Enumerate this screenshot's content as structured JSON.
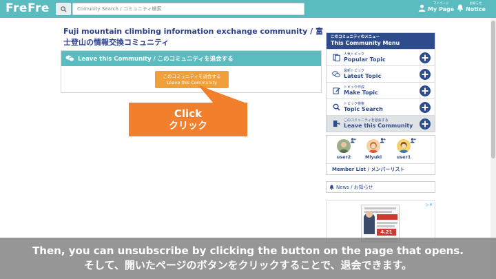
{
  "header": {
    "logo": "FreFre",
    "search_placeholder": "Comunity Search / コミュニティ検索",
    "mypage_small": "マイページ",
    "mypage_label": "My Page",
    "notice_small": "お知らせ",
    "notice_label": "Notice"
  },
  "main": {
    "title": "Fuji mountain climbing information exchange community / 富士登山の情報交換コミュニティ",
    "leave_header": "Leave this Community / このコミュニティを退会する",
    "leave_button_ja": "このコミュニティを退会する",
    "leave_button_en": "Leave this Community"
  },
  "callout": {
    "line1": "Click",
    "line2": "クリック"
  },
  "menu": {
    "head_small": "このコミュニティのメニュー",
    "head_big": "This Community Menu",
    "items": [
      {
        "small": "人気トピック",
        "big": "Popular Topic"
      },
      {
        "small": "最新トピック",
        "big": "Latest Topic"
      },
      {
        "small": "トピック作成",
        "big": "Make Topic"
      },
      {
        "small": "トピック検索",
        "big": "Topic Search"
      },
      {
        "small": "このコミュニティを退会する",
        "big": "Leave this Community"
      }
    ]
  },
  "members": {
    "users": [
      {
        "name": "user2"
      },
      {
        "name": "Miyuki"
      },
      {
        "name": "user1"
      }
    ],
    "list_label": "Member List / メンバーリスト"
  },
  "news": {
    "label": "News / お知らせ"
  },
  "ad": {
    "rate": "4.21"
  },
  "caption": {
    "en": "Then, you can unsubscribe by clicking the button on the page that opens.",
    "ja": "そして、開いたページのボタンをクリックすることで、退会できます。"
  },
  "colors": {
    "header": "#5bbcc0",
    "menu_head": "#2e4c8c",
    "button": "#f0a03a",
    "callout": "#f17f2b"
  }
}
